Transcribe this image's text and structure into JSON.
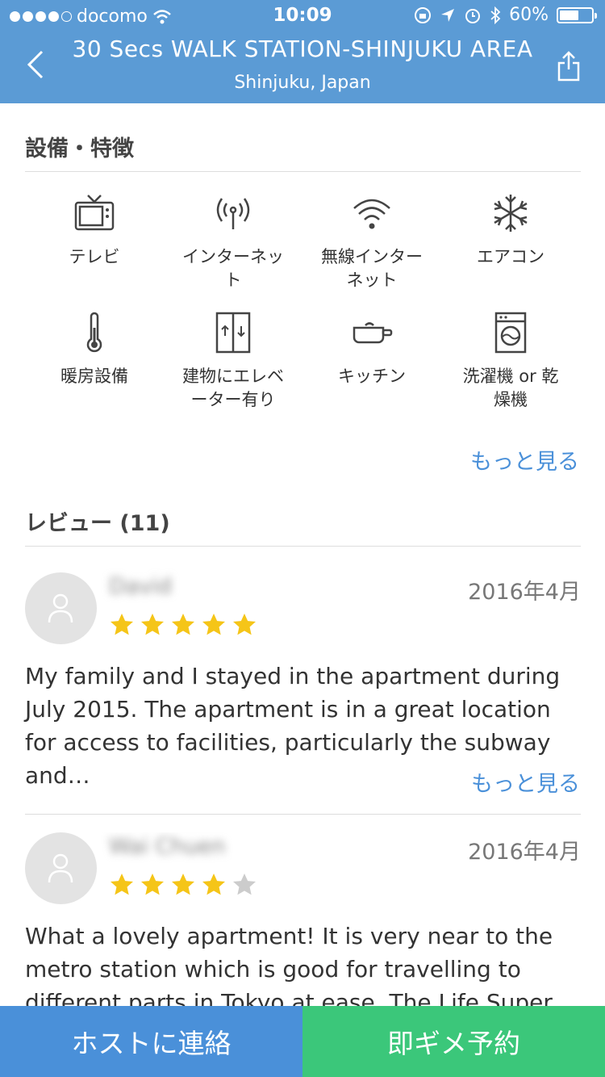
{
  "status_bar": {
    "carrier": "docomo",
    "time": "10:09",
    "battery": "60%",
    "battery_level": 0.6
  },
  "nav": {
    "title": "30 Secs WALK STATION-SHINJUKU AREA",
    "subtitle": "Shinjuku, Japan"
  },
  "amenities": {
    "title": "設備・特徴",
    "items": [
      {
        "label": "テレビ",
        "icon": "tv-icon"
      },
      {
        "label": "インターネット",
        "icon": "antenna-icon"
      },
      {
        "label": "無線インターネット",
        "icon": "wifi-icon"
      },
      {
        "label": "エアコン",
        "icon": "snowflake-icon"
      },
      {
        "label": "暖房設備",
        "icon": "thermometer-icon"
      },
      {
        "label": "建物にエレベーター有り",
        "icon": "elevator-icon"
      },
      {
        "label": "キッチン",
        "icon": "pot-icon"
      },
      {
        "label": "洗濯機 or 乾燥機",
        "icon": "washing-machine-icon"
      }
    ],
    "more": "もっと見る"
  },
  "reviews": {
    "title": "レビュー (11)",
    "items": [
      {
        "name": "David",
        "date": "2016年4月",
        "rating": 5,
        "text": "My family and I stayed in the apartment during July 2015. The apartment is in a great location for access to facilities, particularly the subway and…",
        "more": "もっと見る"
      },
      {
        "name": "Wai Chuen",
        "date": "2016年4月",
        "rating": 4,
        "text": "What a lovely apartment! It is very near to the metro station which is good for travelling to different parts in Tokyo at ease. The Life Super"
      }
    ]
  },
  "footer": {
    "contact": "ホストに連絡",
    "book": "即ギメ予約"
  },
  "colors": {
    "header": "#5b9bd5",
    "link": "#4a90d9",
    "contact_button": "#4a90d9",
    "book_button": "#3bc77a",
    "star": "#f5c518",
    "star_empty": "#cccccc"
  }
}
